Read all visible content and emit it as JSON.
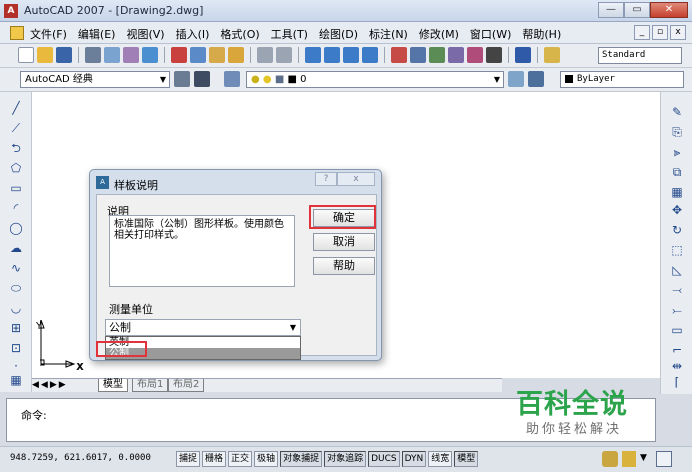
{
  "window": {
    "title": "AutoCAD 2007 - [Drawing2.dwg]",
    "app_icon_text": "A",
    "buttons": {
      "minimize": "—",
      "maximize": "▭",
      "close": "✕"
    }
  },
  "menu": {
    "items": [
      "文件(F)",
      "编辑(E)",
      "视图(V)",
      "插入(I)",
      "格式(O)",
      "工具(T)",
      "绘图(D)",
      "标注(N)",
      "修改(M)",
      "窗口(W)",
      "帮助(H)"
    ],
    "mdi_buttons": [
      "_",
      "▫",
      "x"
    ]
  },
  "toolbar_standard": {
    "text_style": "Standard"
  },
  "toolbar_layers": {
    "workspace": "AutoCAD 经典",
    "layer": "0",
    "linetype": "ByLayer"
  },
  "layout_tabs": {
    "nav": "◀◀▶▶",
    "tabs": [
      "模型",
      "布局1",
      "布局2"
    ]
  },
  "ucs": {
    "y": "Y",
    "x": "X"
  },
  "command_line": {
    "prompt": "命令:"
  },
  "status_bar": {
    "coords": "948.7259, 621.6017, 0.0000",
    "buttons": [
      "捕捉",
      "栅格",
      "正交",
      "极轴",
      "对象捕捉",
      "对象追踪",
      "DUCS",
      "DYN",
      "线宽",
      "模型"
    ]
  },
  "dialog": {
    "title": "样板说明",
    "icon_text": "A",
    "description_label": "说明",
    "description_text": "标准国际（公制）图形样板。使用颜色相关打印样式。",
    "units_label": "测量单位",
    "units_value": "公制",
    "units_options": [
      "英制",
      "公制"
    ],
    "selected_option": "公制",
    "ok_label": "确定",
    "cancel_label": "取消",
    "help_label": "帮助",
    "help_icon": "?",
    "close_icon": "x"
  },
  "watermark": {
    "title": "百科全说",
    "subtitle": "助你轻松解决"
  }
}
